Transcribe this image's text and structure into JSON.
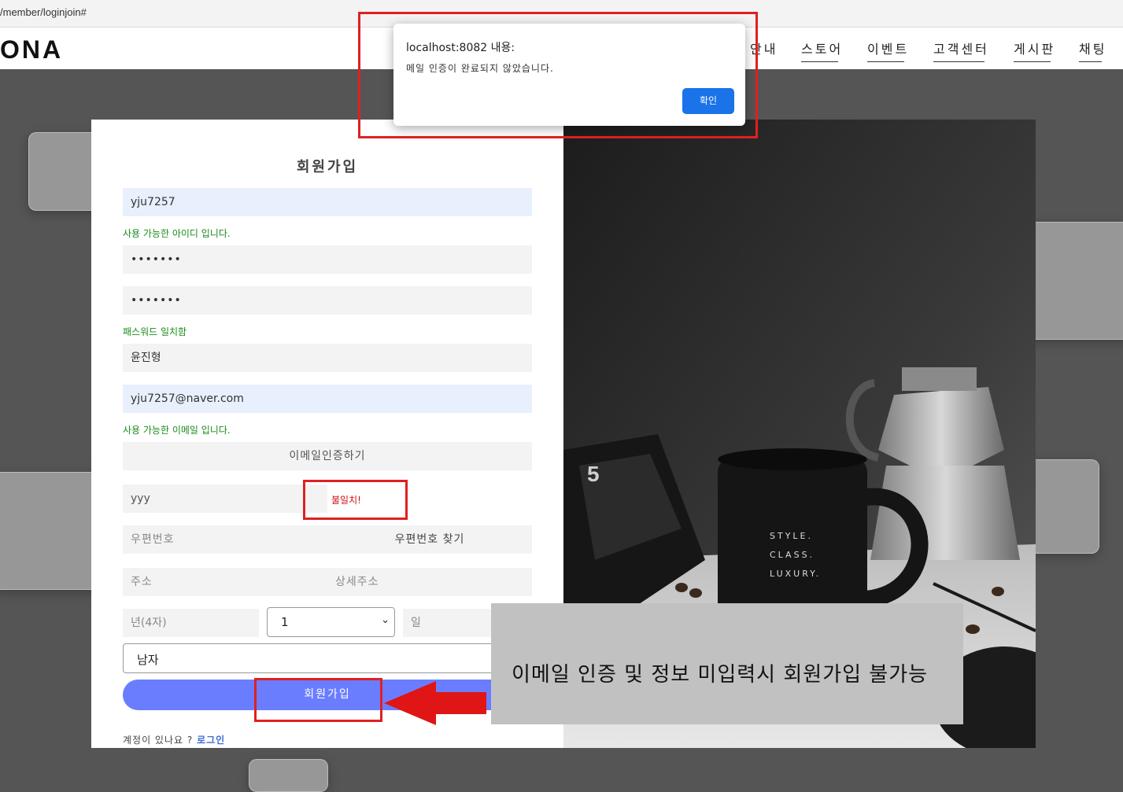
{
  "browser": {
    "url": "/member/loginjoin#"
  },
  "header": {
    "logo": "ONA",
    "nav": [
      "안내",
      "스토어",
      "이벤트",
      "고객센터",
      "게시판",
      "채팅"
    ]
  },
  "form": {
    "title": "회원가입",
    "userid_value": "yju7257",
    "userid_msg": "사용 가능한 아이디 입니다.",
    "password_value": "•••••••",
    "password_confirm_value": "•••••••",
    "password_msg": "패스워드 일치함",
    "name_value": "윤진형",
    "email_value": "yju7257@naver.com",
    "email_msg": "사용 가능한 이메일 입니다.",
    "email_verify_button": "이메일인증하기",
    "verify_code_value": "yyy",
    "verify_code_msg": "불일치!",
    "zipcode_placeholder": "우편번호",
    "zipcode_button": "우편번호 찾기",
    "address_placeholder": "주소",
    "address_detail_placeholder": "상세주소",
    "birth_year_placeholder": "년(4자)",
    "birth_month_value": "1",
    "birth_day_placeholder": "일",
    "gender_value": "남자",
    "submit_button": "회원가입",
    "login_prompt": "계정이 있나요 ?",
    "login_link": "로그인"
  },
  "photo": {
    "mug_lines": [
      "STYLE.",
      "CLASS.",
      "LUXURY."
    ]
  },
  "dialog": {
    "title": "localhost:8082 내용:",
    "message": "메일 인증이 완료되지 않았습니다.",
    "ok_button": "확인"
  },
  "annotation": {
    "text": "이메일 인증 및 정보 미입력시 회원가입 불가능"
  },
  "colors": {
    "accent": "#6b7dff",
    "success": "#1a8c1a",
    "error": "#d01010",
    "highlight": "#e02020",
    "dialog_button": "#1a73e8"
  }
}
